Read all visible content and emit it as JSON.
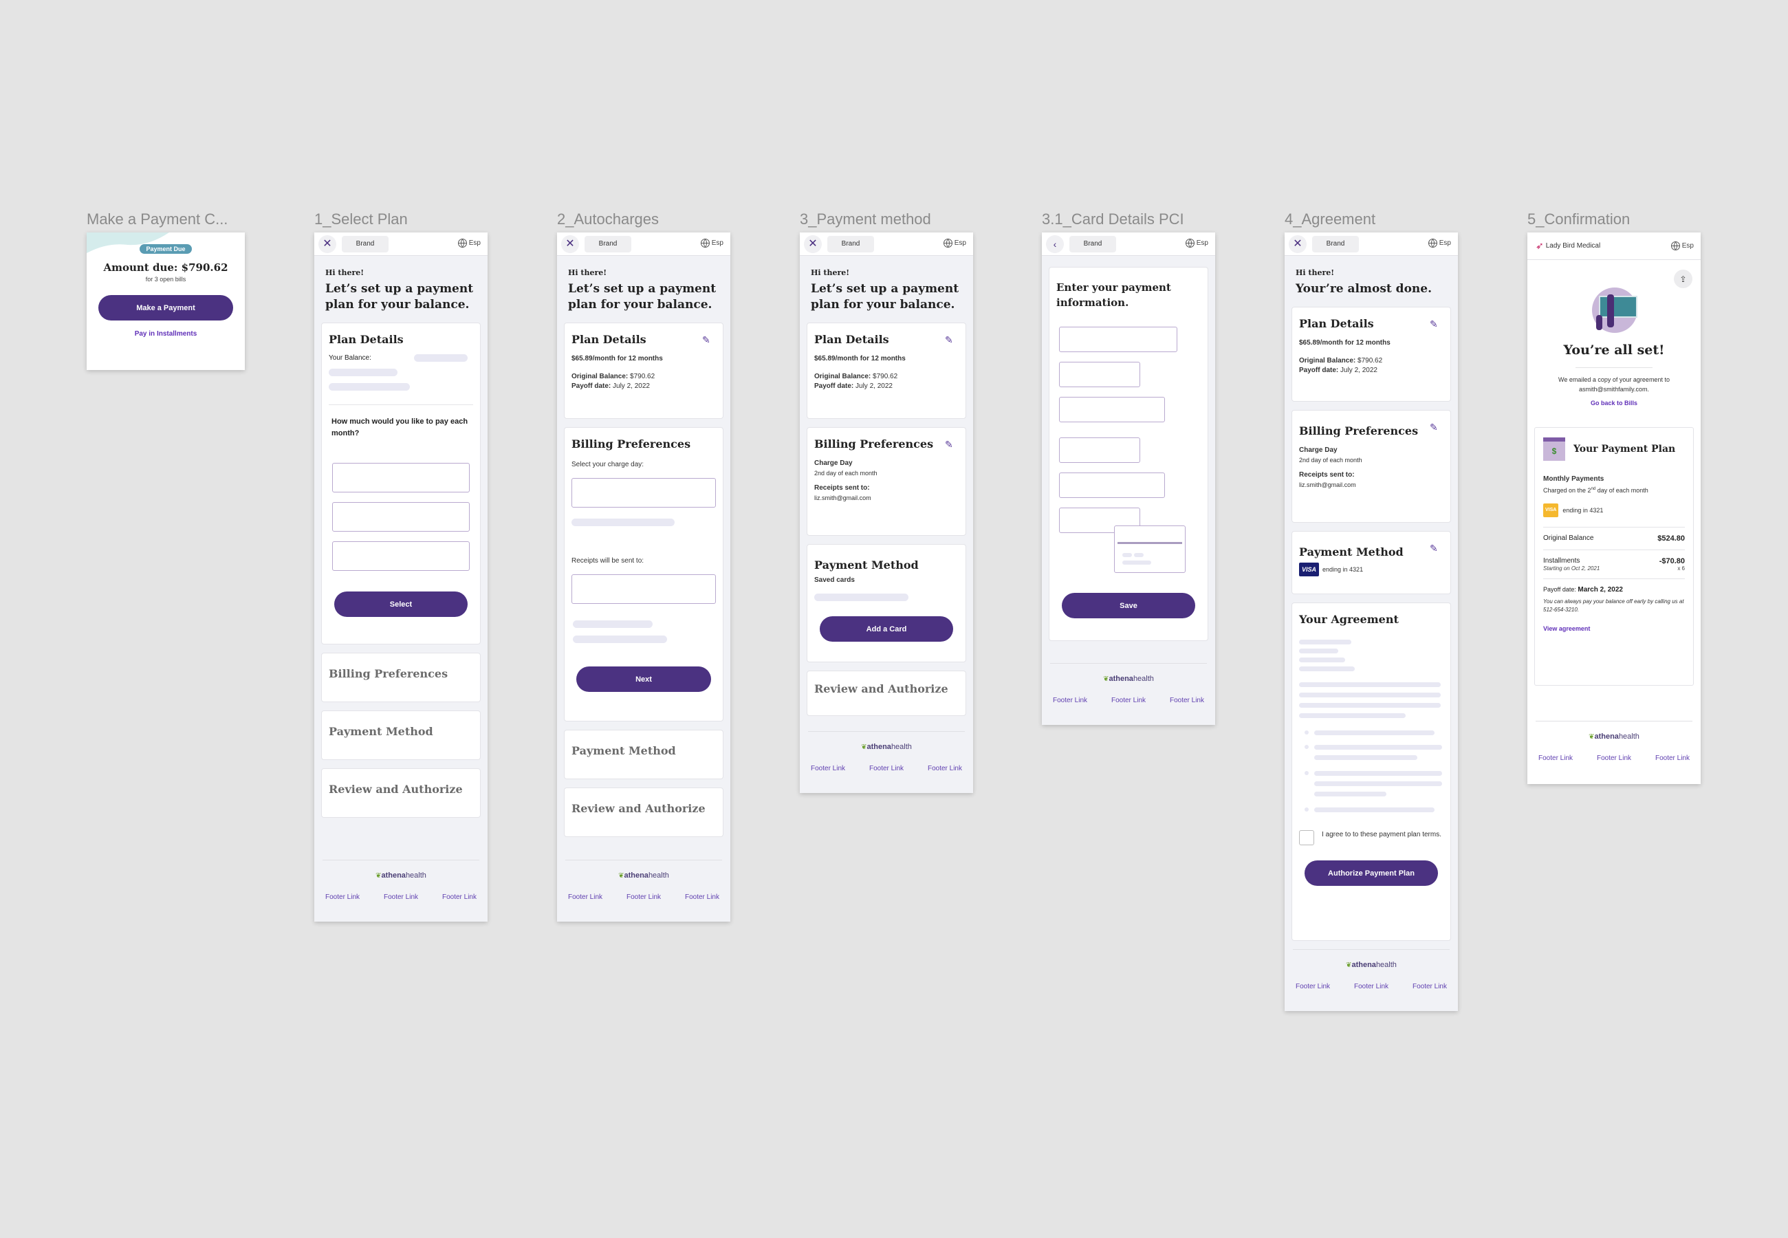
{
  "frames": {
    "make_payment": {
      "label": "Make a Payment C...",
      "badge": "Payment Due",
      "amount_due": "Amount due: $790.62",
      "subtext": "for 3 open bills",
      "primary_button": "Make a Payment",
      "secondary_link": "Pay in Installments"
    },
    "select_plan": {
      "label": "1_Select Plan",
      "brand": "Brand",
      "lang": "Esp",
      "greeting": "Hi there!",
      "headline": "Let’s set up a payment plan for your balance.",
      "plan_card": {
        "title": "Plan Details",
        "balance_label": "Your Balance:",
        "question": "How much would you like to pay each month?",
        "button": "Select"
      },
      "collapsed": [
        "Billing Preferences",
        "Payment Method",
        "Review and Authorize"
      ]
    },
    "autocharges": {
      "label": "2_Autocharges",
      "brand": "Brand",
      "lang": "Esp",
      "greeting": "Hi there!",
      "headline": "Let’s set up a payment plan for your balance.",
      "plan_card": {
        "title": "Plan Details",
        "summary": "$65.89/month for 12 months",
        "orig_label": "Original Balance:",
        "orig_value": "$790.62",
        "payoff_label": "Payoff date:",
        "payoff_value": "July 2, 2022"
      },
      "billing_card": {
        "title": "Billing Preferences",
        "charge_day_label": "Select your charge day:",
        "receipts_label": "Receipts will be sent to:",
        "button": "Next"
      },
      "collapsed": [
        "Payment Method",
        "Review and Authorize"
      ]
    },
    "payment_method": {
      "label": "3_Payment method",
      "brand": "Brand",
      "lang": "Esp",
      "greeting": "Hi there!",
      "headline": "Let’s set up a payment plan for your balance.",
      "plan_card": {
        "title": "Plan Details",
        "summary": "$65.89/month for 12 months",
        "orig_label": "Original Balance:",
        "orig_value": "$790.62",
        "payoff_label": "Payoff date:",
        "payoff_value": "July 2, 2022"
      },
      "billing_card": {
        "title": "Billing Preferences",
        "charge_day_label": "Charge Day",
        "charge_day_value": "2nd day of each month",
        "receipts_label": "Receipts sent to:",
        "receipts_value": "liz.smith@gmail.com"
      },
      "method_card": {
        "title": "Payment Method",
        "saved_label": "Saved cards",
        "button": "Add a Card"
      },
      "collapsed": [
        "Review and Authorize"
      ]
    },
    "card_details": {
      "label": "3.1_Card Details PCI",
      "brand": "Brand",
      "lang": "Esp",
      "headline": "Enter your payment information.",
      "button": "Save"
    },
    "agreement": {
      "label": "4_Agreement",
      "brand": "Brand",
      "lang": "Esp",
      "greeting": "Hi there!",
      "headline": "Your’re almost done.",
      "plan_card": {
        "title": "Plan Details",
        "summary": "$65.89/month for 12 months",
        "orig_label": "Original Balance:",
        "orig_value": "$790.62",
        "payoff_label": "Payoff date:",
        "payoff_value": "July 2, 2022"
      },
      "billing_card": {
        "title": "Billing Preferences",
        "charge_day_label": "Charge Day",
        "charge_day_value": "2nd day of each month",
        "receipts_label": "Receipts sent to:",
        "receipts_value": "liz.smith@gmail.com"
      },
      "method_card": {
        "title": "Payment Method",
        "card_brand": "VISA",
        "card_text": "ending in 4321"
      },
      "agreement_card": {
        "title": "Your Agreement",
        "checkbox_label": "I agree to to these payment plan terms.",
        "button": "Authorize Payment Plan"
      }
    },
    "confirmation": {
      "label": "5_Confirmation",
      "org": "Lady Bird Medical",
      "lang": "Esp",
      "headline": "You’re all set!",
      "email_text": "We emailed a copy of your agreement to",
      "email": "asmith@smithfamily.com.",
      "back_link": "Go back to Bills",
      "plan": {
        "title": "Your Payment Plan",
        "monthly_label": "Monthly Payments",
        "monthly_sub_pre": "Charged on the 2",
        "monthly_sub_sup": "nd",
        "monthly_sub_post": " day of each month",
        "card_brand": "VISA",
        "card_text": "ending in 4321",
        "orig_label": "Original Balance",
        "orig_value": "$524.80",
        "inst_label": "Installments",
        "inst_sub": "Starting on Oct 2, 2021",
        "inst_value": "-$70.80",
        "inst_count": "x 6",
        "payoff_label": "Payoff date:",
        "payoff_value": "March 2, 2022",
        "note": "You can always pay your balance off early by calling us at 512-654-3210.",
        "view_link": "View agreement"
      }
    }
  },
  "footer": {
    "logo_bold": "athena",
    "logo_light": "health",
    "links": [
      "Footer Link",
      "Footer Link",
      "Footer Link"
    ]
  },
  "colors": {
    "primary": "#4b3281",
    "link": "#6030b8",
    "badge": "#5a9cb3",
    "canvas": "#e4e4e4"
  }
}
